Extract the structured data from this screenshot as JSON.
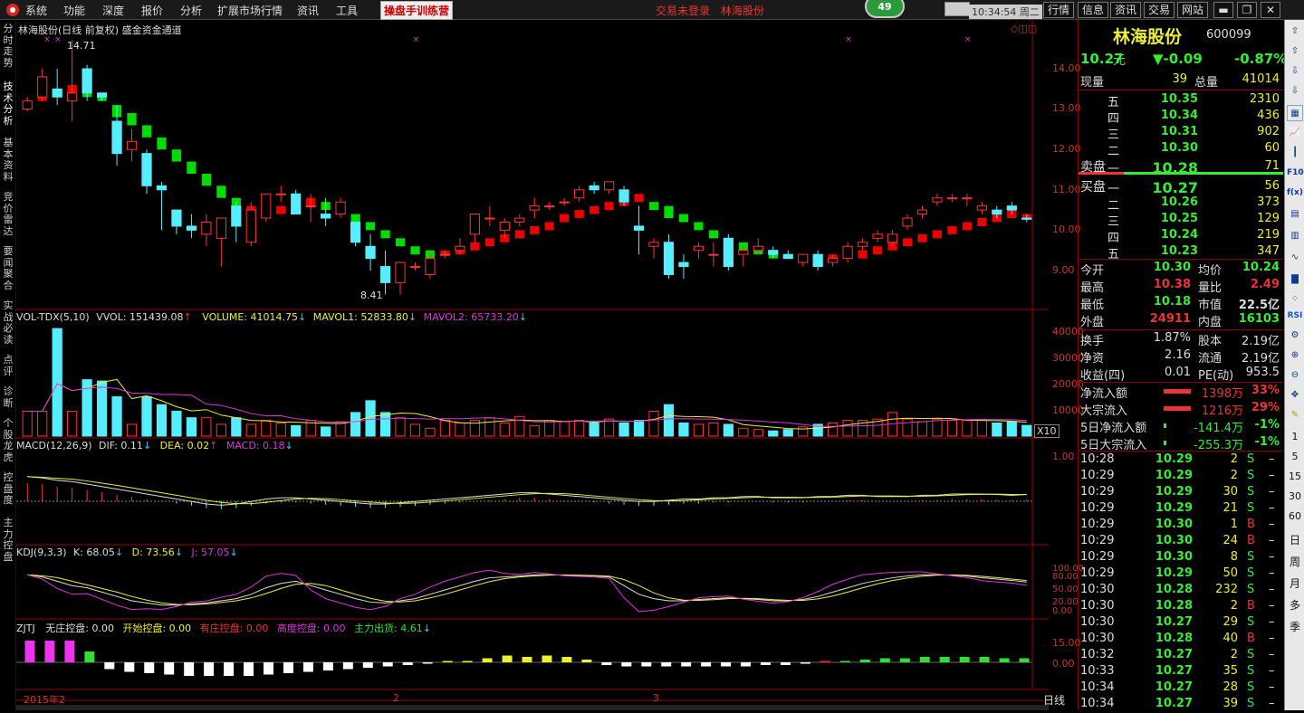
{
  "menu": [
    "系统",
    "功能",
    "深度",
    "报价",
    "分析",
    "扩展市场行情",
    "资讯",
    "工具"
  ],
  "training_label": "操盘手训练营",
  "login_status": "交易未登录",
  "stock_link": "林海股份",
  "badge_count": "49",
  "clock": "10:34:54 周二",
  "right_buttons": [
    "行情",
    "信息",
    "资讯",
    "交易",
    "网站"
  ],
  "left_tabs": [
    "分时走势",
    "技术分析",
    "基本资料",
    "竞价雷达",
    "要闻聚合",
    "实战必读",
    "点评",
    "诊断",
    "个股龙虎",
    "控盘度",
    "主力控盘"
  ],
  "chart_title": "林海股份(日线 前复权) 盛金资金通道",
  "price_high_label": "14.71",
  "price_low_label": "8.41",
  "price_axis": [
    "14.00",
    "13.00",
    "12.00",
    "11.00",
    "10.00",
    "9.00"
  ],
  "vol_line": {
    "name": "VOL-TDX(5,10)",
    "vvol": "VVOL: 151439.08",
    "volume": "VOLUME: 41014.75",
    "mavol1": "MAVOL1: 52833.80",
    "mavol2": "MAVOL2: 65733.20"
  },
  "vol_axis": [
    "40000",
    "30000",
    "20000",
    "10000"
  ],
  "vol_unit": "X10",
  "macd_line": {
    "name": "MACD(12,26,9)",
    "dif": "DIF: 0.11",
    "dea": "DEA: 0.02",
    "macd": "MACD: 0.18"
  },
  "macd_axis": [
    "1.00"
  ],
  "kdj_line": {
    "name": "KDJ(9,3,3)",
    "k": "K: 68.05",
    "d": "D: 73.56",
    "j": "J: 57.05"
  },
  "kdj_axis": [
    "100.00",
    "80.00",
    "50.00",
    "20.00",
    "0.00"
  ],
  "zjtj_line": {
    "name": "ZJTJ",
    "wz": "无庄控盘: 0.00",
    "ks": "开始控盘: 0.00",
    "yz": "有庄控盘: 0.00",
    "gd": "高度控盘: 0.00",
    "zl": "主力出货: 4.61"
  },
  "zjtj_axis": [
    "15.00",
    "0.00"
  ],
  "date_labels": [
    "2015年2",
    "2",
    "3"
  ],
  "period": "日线",
  "quote": {
    "name": "林海股份",
    "code": "600099",
    "price": "10.27",
    "unit": "元",
    "change": "▼-0.09",
    "pct": "-0.87%",
    "xianliang_label": "现量",
    "xianliang": "39",
    "zongliang_label": "总量",
    "zongliang": "41014",
    "asks": [
      [
        "五",
        "10.35",
        "2310"
      ],
      [
        "四",
        "10.34",
        "436"
      ],
      [
        "三",
        "10.31",
        "902"
      ],
      [
        "二",
        "10.30",
        "60"
      ],
      [
        "一",
        "10.28",
        "71"
      ]
    ],
    "bids": [
      [
        "一",
        "10.27",
        "56"
      ],
      [
        "二",
        "10.26",
        "373"
      ],
      [
        "三",
        "10.25",
        "129"
      ],
      [
        "四",
        "10.24",
        "219"
      ],
      [
        "五",
        "10.23",
        "347"
      ]
    ],
    "sell_label": "卖盘",
    "buy_label": "买盘",
    "stats": [
      [
        "今开",
        "10.30",
        "均价",
        "10.24"
      ],
      [
        "最高",
        "10.38",
        "量比",
        "2.49"
      ],
      [
        "最低",
        "10.18",
        "市值",
        "22.5亿"
      ],
      [
        "外盘",
        "24911",
        "内盘",
        "16103"
      ]
    ],
    "stats2": [
      [
        "换手",
        "1.87%",
        "股本",
        "2.19亿"
      ],
      [
        "净资",
        "2.16",
        "流通",
        "2.19亿"
      ],
      [
        "收益(四)",
        "0.01",
        "PE(动)",
        "953.5"
      ]
    ],
    "flows": [
      [
        "净流入额",
        "1398万",
        "33%"
      ],
      [
        "大宗流入",
        "1216万",
        "29%"
      ],
      [
        "5日净流入额",
        "-141.4万",
        "-1%"
      ],
      [
        "5日大宗流入",
        "-255.3万",
        "-1%"
      ]
    ],
    "ticks": [
      [
        "10:28",
        "10.29",
        "2",
        "S"
      ],
      [
        "10:29",
        "10.29",
        "2",
        "S"
      ],
      [
        "10:29",
        "10.29",
        "30",
        "S"
      ],
      [
        "10:29",
        "10.29",
        "21",
        "S"
      ],
      [
        "10:29",
        "10.30",
        "1",
        "B"
      ],
      [
        "10:29",
        "10.30",
        "24",
        "B"
      ],
      [
        "10:29",
        "10.30",
        "8",
        "S"
      ],
      [
        "10:29",
        "10.29",
        "50",
        "S"
      ],
      [
        "10:30",
        "10.28",
        "232",
        "S"
      ],
      [
        "10:30",
        "10.28",
        "2",
        "B"
      ],
      [
        "10:30",
        "10.27",
        "29",
        "S"
      ],
      [
        "10:30",
        "10.28",
        "40",
        "B"
      ],
      [
        "10:32",
        "10.27",
        "2",
        "S"
      ],
      [
        "10:33",
        "10.27",
        "35",
        "S"
      ],
      [
        "10:34",
        "10.27",
        "28",
        "S"
      ],
      [
        "10:34",
        "10.27",
        "39",
        "S"
      ]
    ]
  },
  "right_icons": [
    "1",
    "5",
    "15",
    "30",
    "60",
    "日",
    "周",
    "月",
    "多",
    "季"
  ],
  "chart_data": {
    "type": "candlestick",
    "ohlc": [
      [
        13.0,
        13.3,
        12.95,
        13.2
      ],
      [
        13.3,
        14.0,
        13.2,
        13.8
      ],
      [
        13.5,
        14.0,
        13.1,
        13.3
      ],
      [
        13.2,
        14.71,
        12.7,
        13.4
      ],
      [
        14.0,
        14.1,
        13.2,
        13.4
      ],
      [
        13.4,
        13.4,
        13.2,
        13.3
      ],
      [
        12.7,
        13.1,
        11.6,
        11.9
      ],
      [
        12.0,
        12.5,
        11.7,
        12.2
      ],
      [
        11.9,
        12.0,
        10.9,
        11.1
      ],
      [
        11.1,
        11.2,
        10.0,
        11.0
      ],
      [
        10.5,
        10.5,
        9.9,
        10.1
      ],
      [
        10.1,
        10.4,
        9.8,
        10.0
      ],
      [
        9.9,
        10.4,
        9.6,
        10.2
      ],
      [
        9.8,
        10.2,
        9.1,
        10.3
      ],
      [
        10.6,
        10.7,
        9.7,
        10.1
      ],
      [
        9.7,
        10.7,
        9.6,
        10.5
      ],
      [
        10.3,
        10.9,
        10.2,
        10.9
      ],
      [
        10.9,
        11.1,
        10.7,
        10.9
      ],
      [
        10.9,
        11.0,
        10.8,
        10.4
      ],
      [
        10.6,
        10.9,
        10.2,
        10.6
      ],
      [
        10.4,
        10.8,
        10.1,
        10.3
      ],
      [
        10.4,
        10.8,
        10.3,
        10.7
      ],
      [
        10.2,
        10.2,
        9.6,
        9.7
      ],
      [
        9.6,
        9.9,
        9.0,
        9.3
      ],
      [
        9.1,
        9.5,
        8.41,
        8.7
      ],
      [
        8.7,
        9.2,
        8.4,
        9.2
      ],
      [
        9.1,
        9.2,
        9.0,
        9.1
      ],
      [
        8.9,
        9.4,
        8.8,
        9.3
      ],
      [
        9.4,
        9.5,
        9.3,
        9.4
      ],
      [
        9.5,
        9.8,
        9.4,
        9.6
      ],
      [
        9.9,
        10.4,
        9.7,
        10.4
      ],
      [
        10.3,
        10.6,
        10.1,
        10.3
      ],
      [
        10.0,
        10.3,
        9.8,
        10.2
      ],
      [
        10.2,
        10.4,
        10.1,
        10.3
      ],
      [
        10.5,
        10.8,
        10.3,
        10.6
      ],
      [
        10.6,
        10.7,
        10.5,
        10.6
      ],
      [
        10.7,
        10.8,
        10.6,
        10.7
      ],
      [
        10.8,
        11.1,
        10.7,
        11.0
      ],
      [
        11.1,
        11.2,
        10.9,
        11.0
      ],
      [
        11.0,
        11.2,
        10.9,
        11.2
      ],
      [
        11.0,
        11.1,
        10.6,
        10.7
      ],
      [
        10.1,
        10.6,
        9.4,
        10.0
      ],
      [
        9.6,
        9.8,
        9.3,
        9.7
      ],
      [
        9.7,
        9.9,
        8.8,
        8.9
      ],
      [
        9.2,
        9.4,
        8.8,
        9.1
      ],
      [
        9.5,
        9.7,
        9.3,
        9.6
      ],
      [
        9.4,
        9.7,
        9.1,
        9.4
      ],
      [
        9.8,
        9.9,
        9.0,
        9.1
      ],
      [
        9.4,
        9.6,
        9.1,
        9.5
      ],
      [
        9.5,
        9.8,
        9.4,
        9.6
      ],
      [
        9.5,
        9.6,
        9.3,
        9.4
      ],
      [
        9.4,
        9.5,
        9.3,
        9.3
      ],
      [
        9.2,
        9.4,
        9.1,
        9.4
      ],
      [
        9.4,
        9.5,
        9.0,
        9.1
      ],
      [
        9.2,
        9.4,
        9.1,
        9.3
      ],
      [
        9.3,
        9.7,
        9.2,
        9.6
      ],
      [
        9.6,
        9.8,
        9.5,
        9.7
      ],
      [
        9.8,
        10.0,
        9.7,
        9.9
      ],
      [
        9.7,
        10.0,
        9.6,
        9.9
      ],
      [
        10.1,
        10.4,
        10.0,
        10.3
      ],
      [
        10.4,
        10.6,
        10.3,
        10.5
      ],
      [
        10.7,
        10.9,
        10.6,
        10.8
      ],
      [
        10.8,
        10.9,
        10.7,
        10.8
      ],
      [
        10.8,
        10.9,
        10.6,
        10.8
      ],
      [
        10.5,
        10.7,
        10.4,
        10.6
      ],
      [
        10.5,
        10.6,
        10.3,
        10.4
      ],
      [
        10.6,
        10.7,
        10.4,
        10.5
      ],
      [
        10.3,
        10.4,
        10.2,
        10.27
      ]
    ],
    "channel": [
      [
        13.0,
        13.2,
        1
      ],
      [
        13.2,
        13.4,
        1
      ],
      [
        13.3,
        13.5,
        1
      ],
      [
        13.4,
        13.6,
        1
      ],
      [
        13.3,
        13.5,
        0
      ],
      [
        13.2,
        13.4,
        0
      ],
      [
        12.8,
        13.1,
        0
      ],
      [
        12.6,
        12.9,
        0
      ],
      [
        12.3,
        12.6,
        0
      ],
      [
        12.0,
        12.3,
        0
      ],
      [
        11.7,
        12.0,
        0
      ],
      [
        11.4,
        11.7,
        0
      ],
      [
        11.1,
        11.4,
        0
      ],
      [
        10.8,
        11.1,
        0
      ],
      [
        10.5,
        10.8,
        0
      ],
      [
        10.4,
        10.6,
        1
      ],
      [
        10.3,
        10.5,
        1
      ],
      [
        10.4,
        10.6,
        1
      ],
      [
        10.5,
        10.7,
        1
      ],
      [
        10.6,
        10.8,
        1
      ],
      [
        10.5,
        10.7,
        0
      ],
      [
        10.4,
        10.6,
        0
      ],
      [
        10.2,
        10.4,
        0
      ],
      [
        10.0,
        10.2,
        0
      ],
      [
        9.8,
        10.0,
        0
      ],
      [
        9.6,
        9.8,
        0
      ],
      [
        9.4,
        9.6,
        0
      ],
      [
        9.3,
        9.5,
        0
      ],
      [
        9.4,
        9.5,
        1
      ],
      [
        9.4,
        9.6,
        1
      ],
      [
        9.5,
        9.7,
        1
      ],
      [
        9.6,
        9.8,
        1
      ],
      [
        9.7,
        9.9,
        1
      ],
      [
        9.8,
        10.0,
        1
      ],
      [
        9.9,
        10.1,
        1
      ],
      [
        10.0,
        10.2,
        1
      ],
      [
        10.2,
        10.4,
        1
      ],
      [
        10.3,
        10.5,
        1
      ],
      [
        10.4,
        10.6,
        1
      ],
      [
        10.5,
        10.7,
        1
      ],
      [
        10.6,
        10.8,
        1
      ],
      [
        10.7,
        10.9,
        1
      ],
      [
        10.5,
        10.7,
        0
      ],
      [
        10.3,
        10.6,
        0
      ],
      [
        10.2,
        10.4,
        0
      ],
      [
        10.0,
        10.2,
        0
      ],
      [
        9.8,
        10.0,
        0
      ],
      [
        9.6,
        9.8,
        0
      ],
      [
        9.5,
        9.7,
        0
      ],
      [
        9.4,
        9.6,
        0
      ],
      [
        9.3,
        9.5,
        0
      ],
      [
        9.3,
        9.4,
        0
      ],
      [
        9.3,
        9.4,
        0
      ],
      [
        9.2,
        9.4,
        0
      ],
      [
        9.2,
        9.4,
        1
      ],
      [
        9.3,
        9.4,
        1
      ],
      [
        9.3,
        9.5,
        1
      ],
      [
        9.4,
        9.6,
        1
      ],
      [
        9.5,
        9.7,
        1
      ],
      [
        9.6,
        9.8,
        1
      ],
      [
        9.7,
        9.9,
        1
      ],
      [
        9.8,
        10.0,
        1
      ],
      [
        9.9,
        10.1,
        1
      ],
      [
        10.0,
        10.2,
        1
      ],
      [
        10.1,
        10.3,
        1
      ],
      [
        10.2,
        10.4,
        1
      ],
      [
        10.3,
        10.5,
        1
      ],
      [
        10.3,
        10.4,
        1
      ]
    ],
    "volume": [
      9500,
      9500,
      41000,
      9500,
      21500,
      21000,
      15000,
      4500,
      15000,
      12000,
      9500,
      7000,
      7000,
      4500,
      7000,
      4500,
      6000,
      5000,
      4000,
      6000,
      3500,
      5500,
      9000,
      13500,
      9000,
      7000,
      4500,
      3000,
      6000,
      5000,
      6000,
      7000,
      5000,
      7500,
      4000,
      6000,
      5500,
      6000,
      5000,
      6500,
      5000,
      6000,
      9500,
      12000,
      5000,
      4500,
      5000,
      4500,
      3000,
      2500,
      2000,
      2500,
      3500,
      4500,
      5000,
      6000,
      6000,
      6500,
      9000,
      6500,
      5500,
      6500,
      6000,
      6000,
      6000,
      5000,
      5500,
      4100
    ],
    "macd": [
      0.9,
      0.85,
      0.75,
      0.7,
      0.6,
      0.5,
      0.4,
      0.3,
      0.2,
      0.1,
      0.0,
      -0.1,
      -0.2,
      -0.25,
      -0.2,
      -0.1,
      0.0,
      0.05,
      0.05,
      0.0,
      -0.05,
      -0.1,
      -0.15,
      -0.2,
      -0.2,
      -0.15,
      -0.1,
      -0.05,
      0.0,
      0.05,
      0.1,
      0.15,
      0.2,
      0.25,
      0.25,
      0.2,
      0.15,
      0.1,
      0.05,
      0.0,
      -0.05,
      -0.1,
      -0.1,
      -0.05,
      0.0,
      0.0,
      0.05,
      0.05,
      0.1,
      0.1,
      0.05,
      0.05,
      0.05,
      0.1,
      0.1,
      0.15,
      0.15,
      0.1,
      0.1,
      0.1,
      0.15,
      0.15,
      0.2,
      0.2,
      0.2,
      0.18,
      0.15,
      0.18
    ],
    "kdj_k": [
      85,
      80,
      70,
      60,
      55,
      45,
      35,
      25,
      20,
      15,
      15,
      18,
      20,
      25,
      30,
      40,
      55,
      65,
      70,
      60,
      50,
      40,
      30,
      22,
      20,
      25,
      30,
      40,
      50,
      60,
      70,
      78,
      80,
      82,
      85,
      85,
      84,
      83,
      82,
      80,
      60,
      40,
      30,
      25,
      25,
      28,
      30,
      32,
      30,
      28,
      25,
      25,
      28,
      35,
      45,
      55,
      65,
      72,
      78,
      82,
      85,
      85,
      84,
      82,
      78,
      75,
      72,
      68
    ],
    "zjtj": [
      16,
      16,
      16,
      8,
      -5,
      -7,
      -8,
      -9,
      -10,
      -10,
      -10,
      -10,
      -9,
      -8,
      -7,
      -6,
      -5,
      -4,
      -3,
      -2,
      -1,
      1,
      1,
      3,
      5,
      4,
      5,
      4,
      2,
      -2,
      -3,
      -3,
      -3,
      -3,
      -3,
      -3,
      -3,
      -2,
      -2,
      -1,
      1,
      1,
      2,
      3,
      3,
      4,
      4,
      4,
      4,
      3,
      3
    ]
  }
}
